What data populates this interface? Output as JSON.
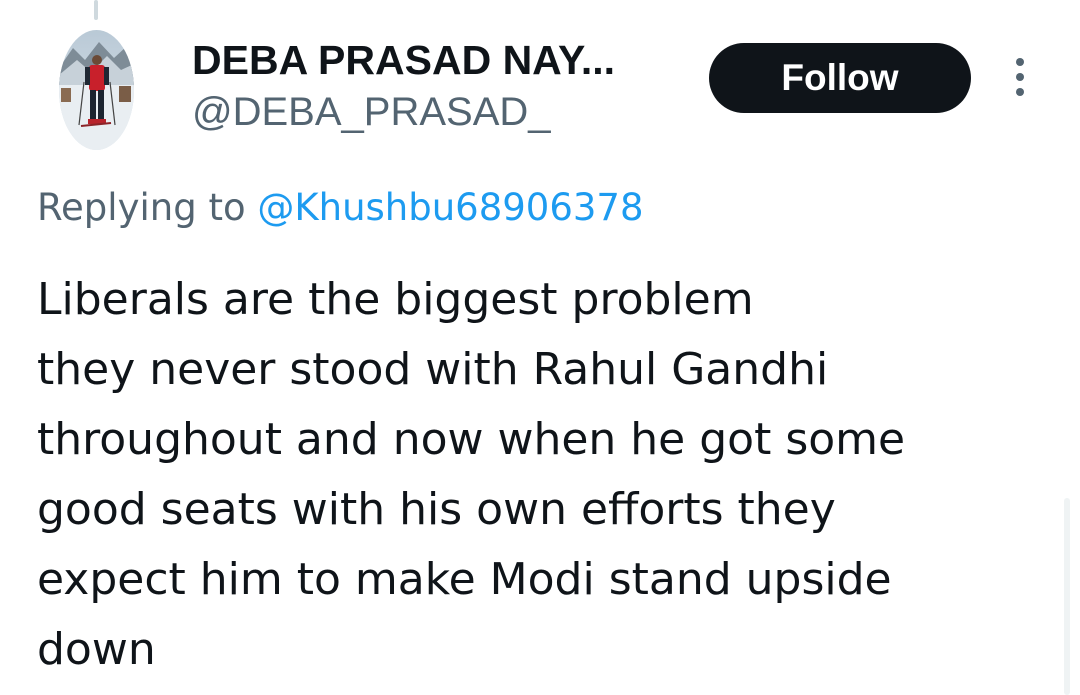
{
  "author": {
    "display_name": "DEBA PRASAD NAY...",
    "handle": "@DEBA_PRASAD_"
  },
  "actions": {
    "follow_label": "Follow"
  },
  "reply": {
    "prefix": "Replying to ",
    "handle": "@Khushbu68906378"
  },
  "tweet": {
    "lines": [
      "Liberals are the biggest problem",
      "they never stood with Rahul Gandhi",
      "throughout and now when he got some",
      "good seats with his own efforts they",
      "expect him to make Modi stand upside",
      "down"
    ]
  },
  "colors": {
    "text_primary": "#0f1419",
    "text_secondary": "#536471",
    "link": "#1d9bf0",
    "follow_bg": "#0f1419",
    "follow_text": "#ffffff"
  },
  "icons": {
    "avatar": "skier-photo-avatar",
    "more": "more-options-icon"
  }
}
